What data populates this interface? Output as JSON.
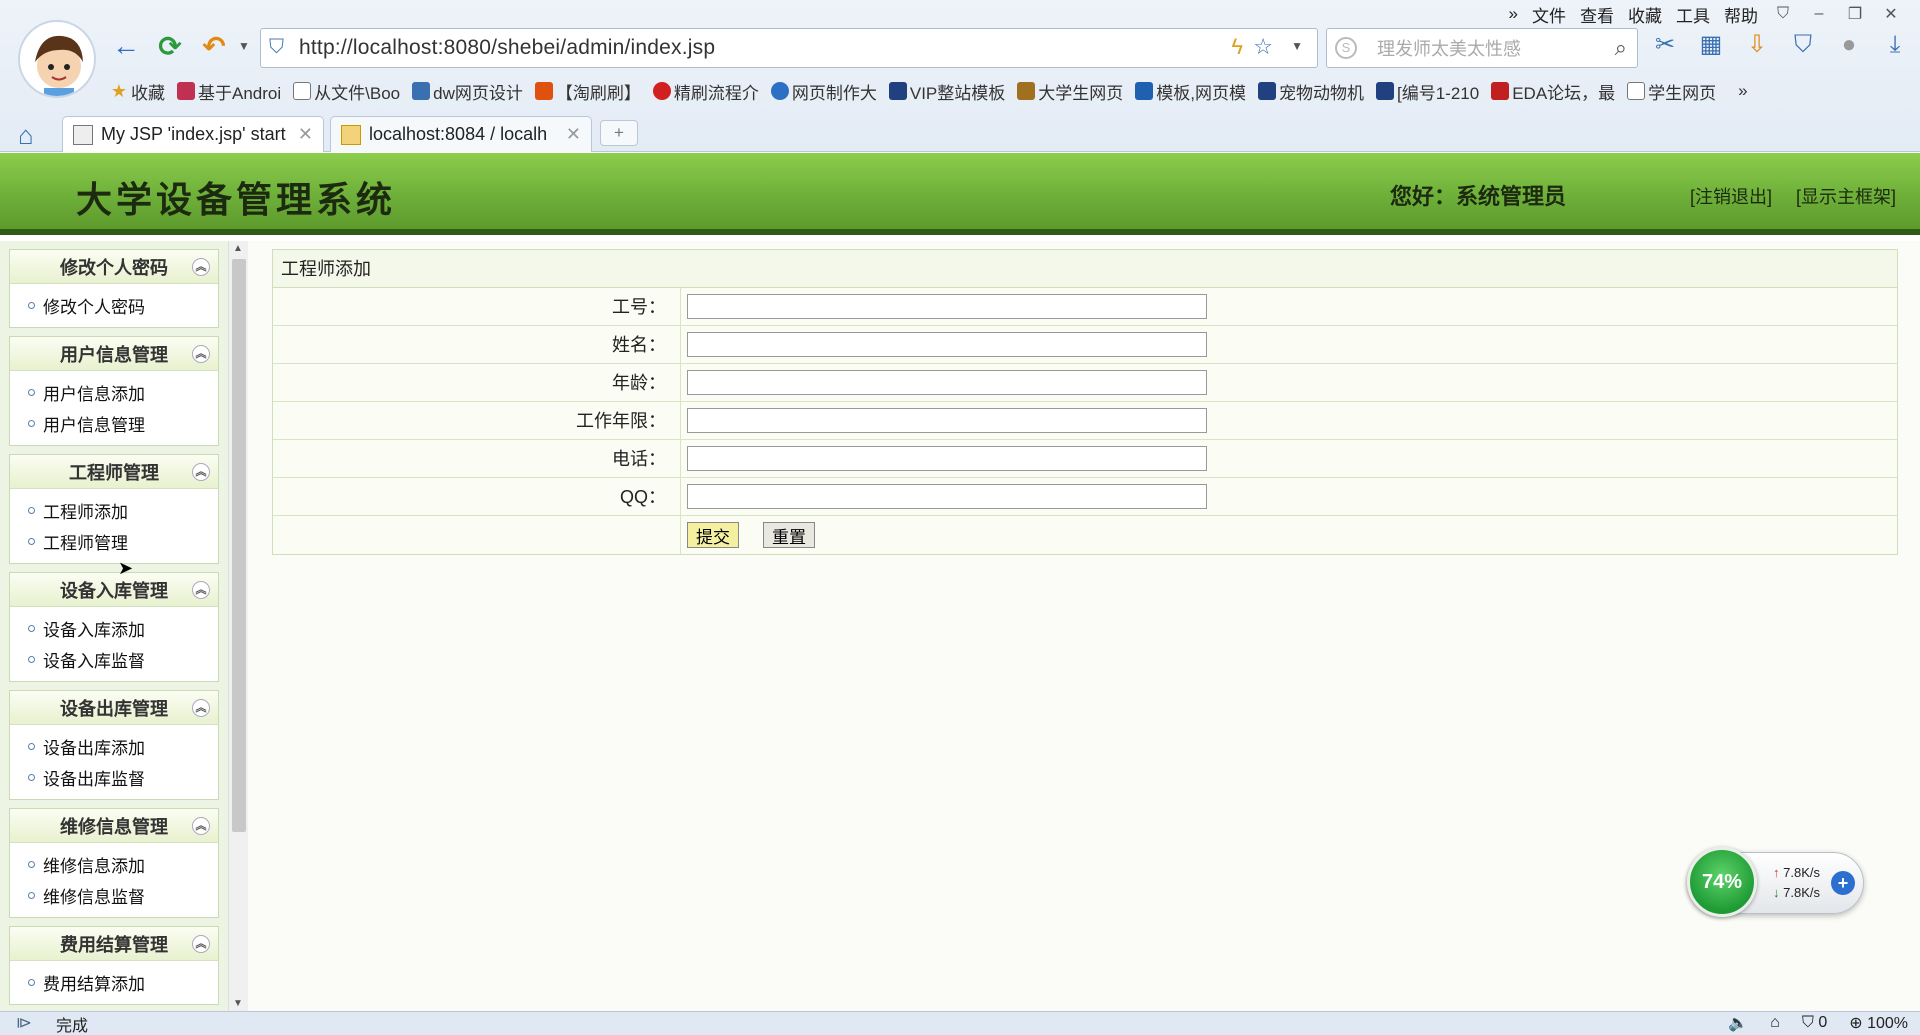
{
  "browser": {
    "menu": [
      "文件",
      "查看",
      "收藏",
      "工具",
      "帮助"
    ],
    "address_url": "http://localhost:8080/shebei/admin/index.jsp",
    "search_placeholder": "理发师太美太性感",
    "bookmarks": [
      "收藏",
      "基于Androi",
      "从文件\\Boo",
      "dw网页设计",
      "【淘刷刷】",
      "精刷流程介",
      "网页制作大",
      "VIP整站模板",
      "大学生网页",
      "模板,网页模",
      "宠物动物机",
      "[编号1-210",
      "EDA论坛，最",
      "学生网页"
    ],
    "tabs": [
      {
        "title": "My JSP 'index.jsp' start",
        "active": true
      },
      {
        "title": "localhost:8084 / localh",
        "active": false
      }
    ],
    "status_text": "完成",
    "zoom": "100%",
    "blocked_count": "0"
  },
  "app": {
    "title": "大学设备管理系统",
    "greeting": "您好：系统管理员",
    "logout": "[注销退出]",
    "show_main_frame": "[显示主框架]"
  },
  "sidebar": {
    "groups": [
      {
        "title": "修改个人密码",
        "items": [
          "修改个人密码"
        ]
      },
      {
        "title": "用户信息管理",
        "items": [
          "用户信息添加",
          "用户信息管理"
        ]
      },
      {
        "title": "工程师管理",
        "items": [
          "工程师添加",
          "工程师管理"
        ]
      },
      {
        "title": "设备入库管理",
        "items": [
          "设备入库添加",
          "设备入库监督"
        ]
      },
      {
        "title": "设备出库管理",
        "items": [
          "设备出库添加",
          "设备出库监督"
        ]
      },
      {
        "title": "维修信息管理",
        "items": [
          "维修信息添加",
          "维修信息监督"
        ]
      },
      {
        "title": "费用结算管理",
        "items": [
          "费用结算添加"
        ]
      }
    ]
  },
  "form": {
    "title": "工程师添加",
    "fields": [
      {
        "label": "工号：",
        "value": ""
      },
      {
        "label": "姓名：",
        "value": ""
      },
      {
        "label": "年龄：",
        "value": ""
      },
      {
        "label": "工作年限：",
        "value": ""
      },
      {
        "label": "电话：",
        "value": ""
      },
      {
        "label": "QQ：",
        "value": ""
      }
    ],
    "submit_label": "提交",
    "reset_label": "重置"
  },
  "net_widget": {
    "percent": "74%",
    "upload": "7.8K/s",
    "download": "7.8K/s"
  }
}
